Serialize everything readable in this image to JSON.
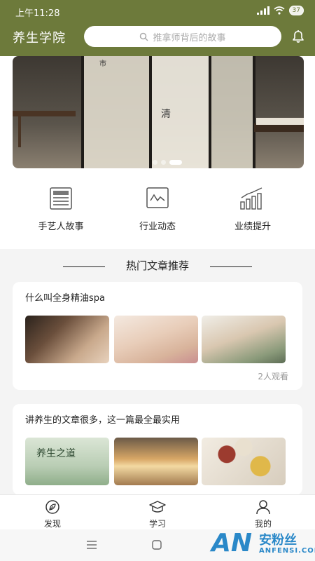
{
  "status": {
    "time": "上午11:28",
    "battery": "37"
  },
  "header": {
    "title": "养生学院",
    "search_placeholder": "推拿师背后的故事"
  },
  "banner": {
    "sign_char": "清",
    "sign_char_2": "市"
  },
  "quick_links": [
    {
      "label": "手艺人故事"
    },
    {
      "label": "行业动态"
    },
    {
      "label": "业绩提升"
    }
  ],
  "section": {
    "title": "热门文章推荐"
  },
  "articles": [
    {
      "title": "什么叫全身精油spa",
      "views": "2人观看"
    },
    {
      "title": "讲养生的文章很多，这一篇最全最实用",
      "thumb_text": "养生之道"
    }
  ],
  "tabbar": [
    {
      "label": "发现"
    },
    {
      "label": "学习"
    },
    {
      "label": "我的"
    }
  ],
  "watermark": {
    "logo": "AN",
    "cn": "安粉丝",
    "en": "ANFENSI.COM"
  },
  "colors": {
    "primary": "#6d7a3b",
    "background": "#f4f4f4"
  }
}
